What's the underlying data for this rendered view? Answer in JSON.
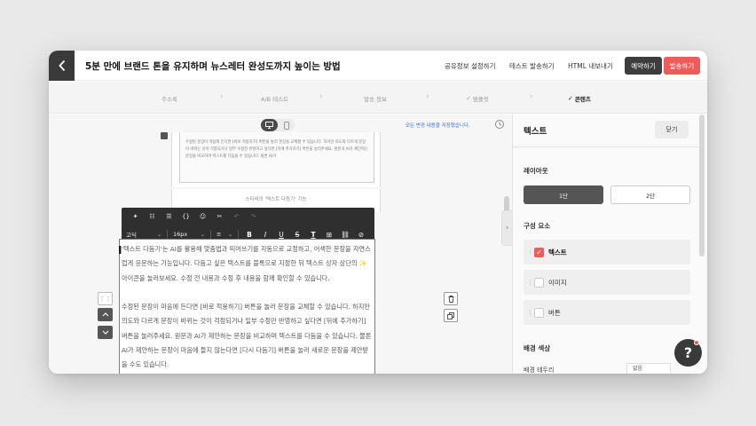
{
  "header": {
    "title": "5분 만에 브랜드 톤을 유지하며 뉴스레터 완성도까지 높이는 방법",
    "links": [
      "공유정보 설정하기",
      "테스트 발송하기",
      "HTML 내보내기"
    ],
    "reserve_label": "예약하기",
    "send_label": "발송하기"
  },
  "steps": [
    "주소록",
    "A/B 테스트",
    "발송 정보",
    "템플릿",
    "콘텐츠"
  ],
  "editor": {
    "autosave": "모든 변경 내용을 저장했습니다.",
    "thumb_text": "수정된 문장이 마음에 든다면 [바로 적용하기] 버튼을 눌러 문장을 교체할 수 있습니다. 하지만 의도와 다르게 문장이 바뀌는 것이 걱정되거나 일부 수정한 반영하고 싶다면 [뒤에 추가하기] 버튼을 눌러주세요. 원문과 AI가 제안하는 문장을 비교하며 텍스트를 다듬을 수 있습니다. 물론 AI가",
    "caption": "스티비의 '텍스트 다듬기' 기능",
    "toolbar": {
      "font": "고딕",
      "size": "16px"
    },
    "paragraph1": "'텍스트 다듬기'는 AI를 활용해 맞춤법과 띄어쓰기를 자동으로 교정하고, 어색한 문장을 자연스럽게 윤문하는 기능입니다. 다듬고 싶은 텍스트를 블록으로 지정한 뒤 텍스트 상자 상단의 ✨ 아이콘을 눌러보세요. 수정 전 내용과 수정 후 내용을 함께 확인할 수 있습니다.",
    "paragraph2": "수정된 문장이 마음에 든다면 [바로 적용하기] 버튼을 눌러 문장을 교체할 수 있습니다. 하지만 의도와 다르게 문장이 바뀌는 것이 걱정되거나 일부 수정만 반영하고 싶다면 [뒤에 추가하기] 버튼을 눌러주세요. 원문과 AI가 제안하는 문장을 비교하며 텍스트를 다듬을 수 있습니다. 물론 AI가 제안하는 문장이 마음에 들지 않는다면 [다시 다듬기] 버튼을 눌러 새로운 문장을 제안받을 수도 있습니다."
  },
  "panel": {
    "title": "텍스트",
    "close_label": "닫기",
    "layout_label": "레이아웃",
    "layout_one": "1단",
    "layout_two": "2단",
    "components_label": "구성 요소",
    "components": [
      "텍스트",
      "이미지",
      "버튼"
    ],
    "bg_label": "배경 색상",
    "bg_row": "배경 테두리",
    "bg_select": "없음"
  },
  "colors": {
    "accent": "#ef5b5b",
    "dark": "#3a3a3a",
    "link": "#3b6fd8"
  }
}
